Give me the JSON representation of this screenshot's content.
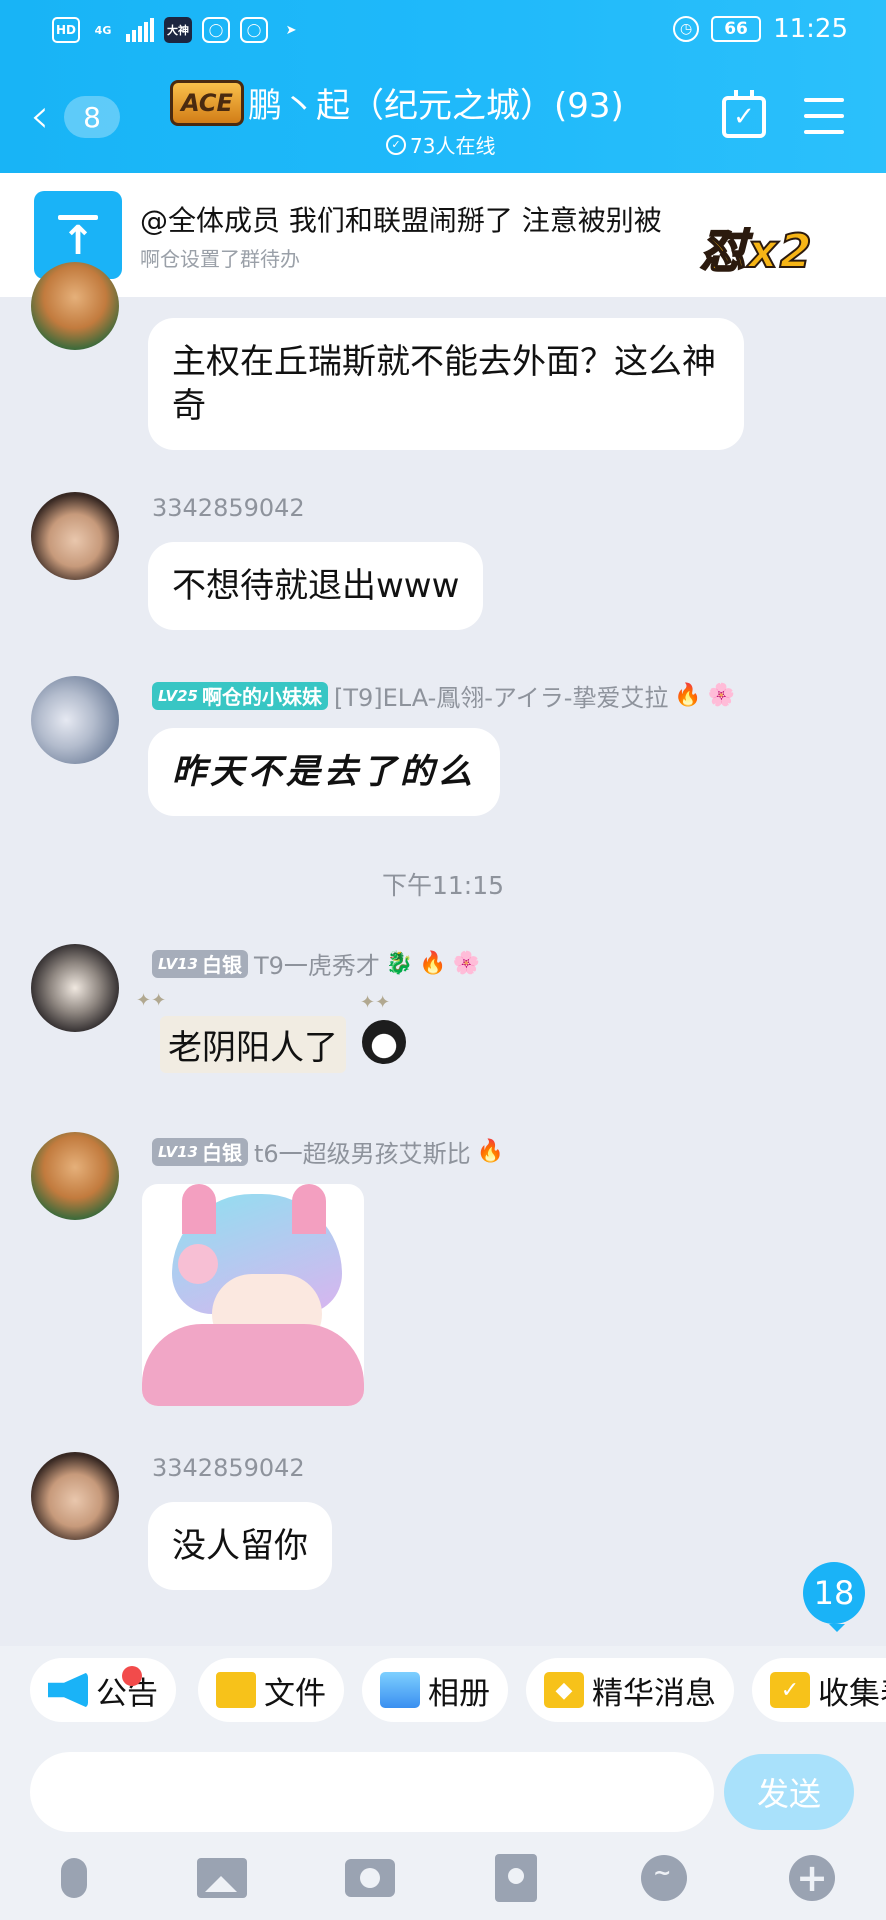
{
  "status_bar": {
    "left_icons": [
      "HD",
      "4G",
      "大神"
    ],
    "battery": "66",
    "time": "11:25"
  },
  "header": {
    "back_count": "8",
    "group_logo": "ACE",
    "title": "鹏丶起（纪元之城）(93)",
    "online": "73人在线",
    "icons": [
      "calendar-check-icon",
      "menu-icon"
    ],
    "bg_color": "#1fb9fa"
  },
  "todo": {
    "text": "@全体成员 我们和联盟闹掰了  注意被别被",
    "sub": "啊仓设置了群待办",
    "sticker": "怼x2"
  },
  "messages": [
    {
      "text": "主权在丘瑞斯就不能去外面？这么神奇"
    },
    {
      "sender": "3342859042",
      "text": "不想待就退出www"
    },
    {
      "level": "LV25",
      "title": "啊仓的小妹妹",
      "sender": "[T9]ELA-鳳翎-アイラ-挚爱艾拉",
      "text": "昨天不是去了的么"
    },
    {
      "level": "LV13",
      "title": "白银",
      "sender": "T9一虎秀才",
      "text": "老阴阳人了"
    },
    {
      "level": "LV13",
      "title": "白银",
      "sender": "t6一超级男孩艾斯比",
      "text": ""
    },
    {
      "sender": "3342859042",
      "text": "没人留你"
    }
  ],
  "timestamp": "下午11:15",
  "unread_count": "18",
  "shortcuts": [
    "公告",
    "文件",
    "相册",
    "精华消息",
    "收集表"
  ],
  "input": {
    "placeholder": "",
    "send_label": "发送"
  },
  "toolbar_icons": [
    "mic-icon",
    "image-icon",
    "camera-icon",
    "red-packet-icon",
    "emoji-icon",
    "plus-icon"
  ]
}
